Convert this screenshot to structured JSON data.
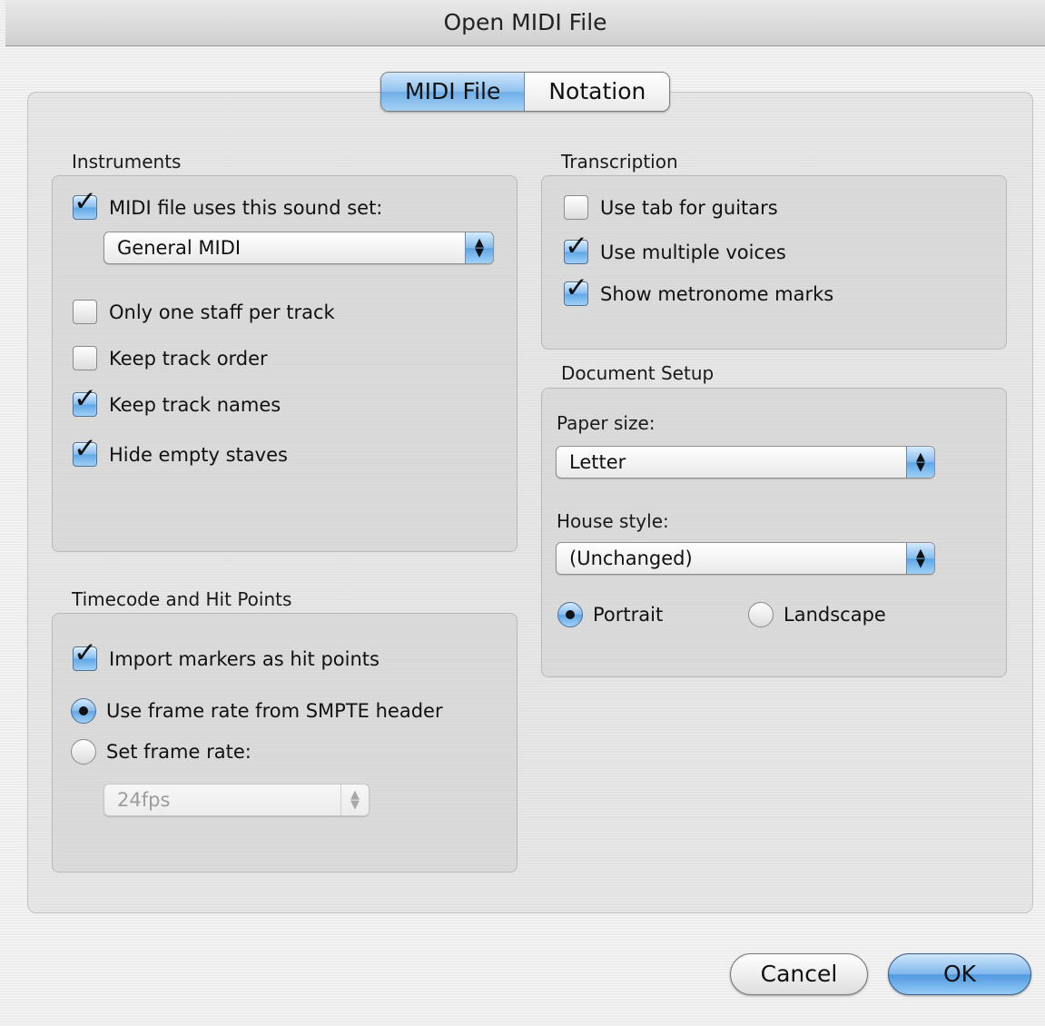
{
  "window": {
    "title": "Open MIDI File"
  },
  "tabs": [
    {
      "label": "MIDI File",
      "selected": true
    },
    {
      "label": "Notation",
      "selected": false
    }
  ],
  "instruments": {
    "title": "Instruments",
    "sound_set_checkbox": {
      "label": "MIDI file uses this sound set:",
      "checked": true
    },
    "sound_set_popup": {
      "value": "General MIDI"
    },
    "options": [
      {
        "label": "Only one staff per track",
        "checked": false
      },
      {
        "label": "Keep track order",
        "checked": false
      },
      {
        "label": "Keep track names",
        "checked": true
      },
      {
        "label": "Hide empty staves",
        "checked": true
      }
    ]
  },
  "timecode": {
    "title": "Timecode and Hit Points",
    "import_markers": {
      "label": "Import markers as hit points",
      "checked": true
    },
    "frame_rate_smpte": {
      "label": "Use frame rate from SMPTE header",
      "selected": true
    },
    "frame_rate_set": {
      "label": "Set frame rate:",
      "selected": false
    },
    "frame_rate_popup": {
      "value": "24fps",
      "enabled": false
    }
  },
  "transcription": {
    "title": "Transcription",
    "options": [
      {
        "label": "Use tab for guitars",
        "checked": false
      },
      {
        "label": "Use multiple voices",
        "checked": true
      },
      {
        "label": "Show metronome marks",
        "checked": true
      }
    ]
  },
  "document_setup": {
    "title": "Document Setup",
    "paper_size_label": "Paper size:",
    "paper_size_value": "Letter",
    "house_style_label": "House style:",
    "house_style_value": "(Unchanged)",
    "portrait": {
      "label": "Portrait",
      "selected": true
    },
    "landscape": {
      "label": "Landscape",
      "selected": false
    }
  },
  "buttons": {
    "cancel": "Cancel",
    "ok": "OK"
  },
  "colors": {
    "accent": "#6eaee8",
    "window_bg": "#ececec"
  }
}
